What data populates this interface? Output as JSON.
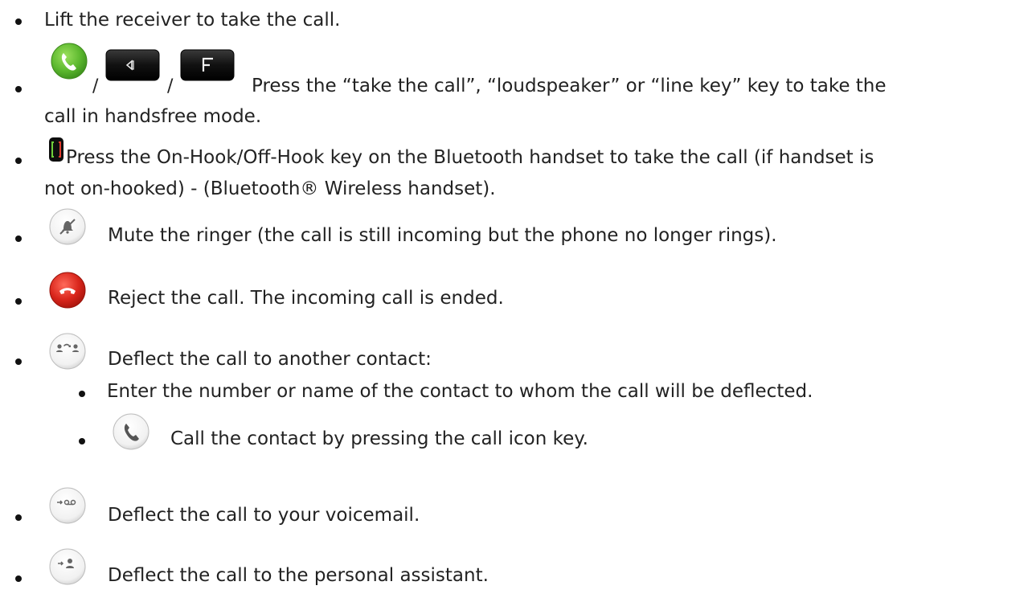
{
  "items": {
    "lift": {
      "text": "Lift the receiver to take the call."
    },
    "handsfree": {
      "icons": [
        "take-call-icon",
        "loudspeaker-icon",
        "line-key-icon"
      ],
      "separator": "/",
      "line1": "Press the “take the call”, “loudspeaker” or “line key” key to take the",
      "line2": "call in handsfree mode."
    },
    "bluetooth": {
      "icon": "bluetooth-handset-icon",
      "line1": "Press the On-Hook/Off-Hook key on the Bluetooth handset to take the call (if handset is",
      "line2": "not on-hooked) - (Bluetooth® Wireless handset)."
    },
    "mute": {
      "icon": "mute-ringer-icon",
      "text": "Mute the ringer (the call is still incoming but the phone no longer rings)."
    },
    "reject": {
      "icon": "reject-call-icon",
      "text": "Reject the call. The incoming call is ended."
    },
    "deflect": {
      "icon": "deflect-contact-icon",
      "text": "Deflect the call to another contact:",
      "sub": [
        {
          "text": "Enter the number or name of the contact to whom the call will be deflected."
        },
        {
          "icon": "call-icon",
          "text": "Call the contact by pressing the call icon key."
        }
      ]
    },
    "voicemail": {
      "icon": "deflect-voicemail-icon",
      "text": "Deflect the call to your voicemail."
    },
    "assistant": {
      "icon": "deflect-assistant-icon",
      "text": "Deflect the call to the personal assistant."
    }
  },
  "colors": {
    "green": "#5cb82e",
    "red": "#d9261c",
    "key_dark": "#111111",
    "text": "#222222"
  }
}
